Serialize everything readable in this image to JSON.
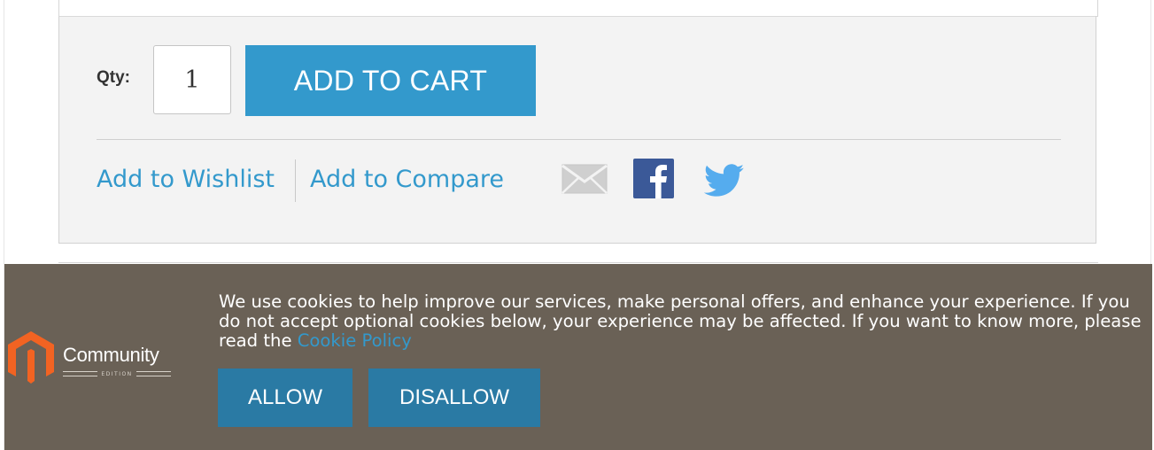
{
  "product": {
    "qty_label": "Qty:",
    "qty_value": "1",
    "add_to_cart_label": "ADD TO CART",
    "wishlist_label": "Add to Wishlist",
    "compare_label": "Add to Compare",
    "share_icons": [
      "mail-icon",
      "facebook-icon",
      "twitter-icon"
    ]
  },
  "cookie_notice": {
    "text": "We use cookies to help improve our services, make personal offers, and enhance your experience. If you do not accept optional cookies below, your experience may be affected. If you want to know more, please read the ",
    "link_label": "Cookie Policy",
    "allow_label": "ALLOW",
    "disallow_label": "DISALLOW",
    "brand_name": "Community",
    "brand_edition": "EDITION",
    "brand_icon": "magento-logo-icon"
  },
  "colors": {
    "accent": "#3399cc",
    "cookie_bar_bg": "#6a6156",
    "cookie_button": "#2a7aa4",
    "panel_bg": "#f3f3f3",
    "brand_orange": "#f26322",
    "facebook_blue": "#3b5998",
    "twitter_blue": "#55acee"
  }
}
